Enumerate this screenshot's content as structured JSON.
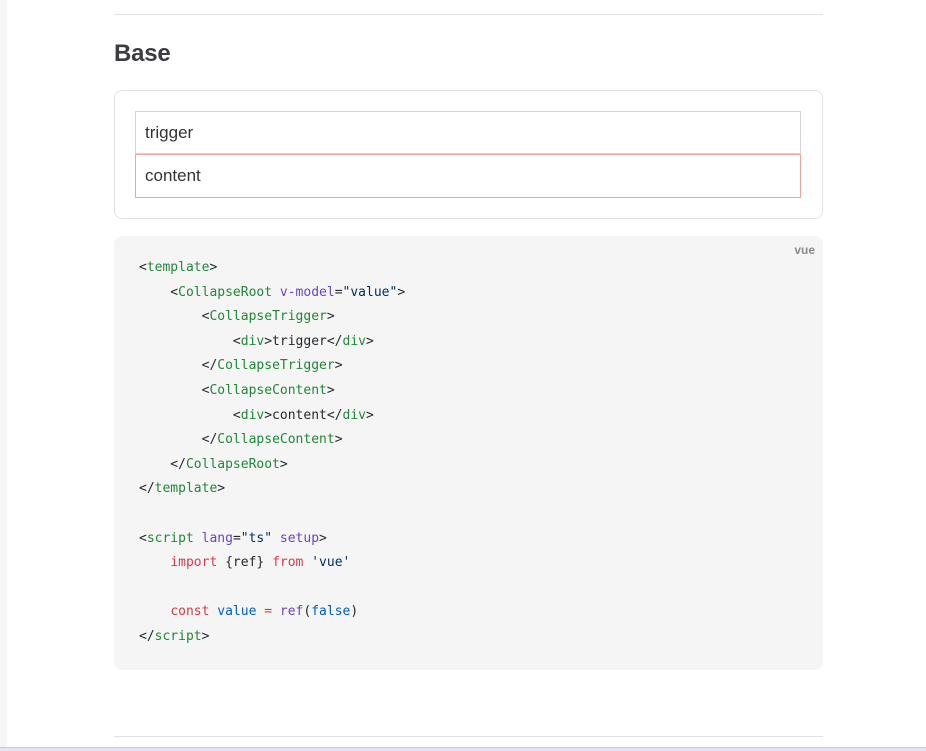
{
  "section": {
    "title": "Base"
  },
  "demo": {
    "trigger_text": "trigger",
    "content_text": "content"
  },
  "code_block": {
    "language": "vue",
    "lines": [
      [
        {
          "c": "p",
          "t": "<"
        },
        {
          "c": "t",
          "t": "template"
        },
        {
          "c": "p",
          "t": ">"
        }
      ],
      [
        {
          "c": "p",
          "t": "    <"
        },
        {
          "c": "t",
          "t": "CollapseRoot"
        },
        {
          "c": "p",
          "t": " "
        },
        {
          "c": "a",
          "t": "v-model"
        },
        {
          "c": "p",
          "t": "="
        },
        {
          "c": "s",
          "t": "\"value\""
        },
        {
          "c": "p",
          "t": ">"
        }
      ],
      [
        {
          "c": "p",
          "t": "        <"
        },
        {
          "c": "t",
          "t": "CollapseTrigger"
        },
        {
          "c": "p",
          "t": ">"
        }
      ],
      [
        {
          "c": "p",
          "t": "            <"
        },
        {
          "c": "t",
          "t": "div"
        },
        {
          "c": "p",
          "t": ">trigger</"
        },
        {
          "c": "t",
          "t": "div"
        },
        {
          "c": "p",
          "t": ">"
        }
      ],
      [
        {
          "c": "p",
          "t": "        </"
        },
        {
          "c": "t",
          "t": "CollapseTrigger"
        },
        {
          "c": "p",
          "t": ">"
        }
      ],
      [
        {
          "c": "p",
          "t": "        <"
        },
        {
          "c": "t",
          "t": "CollapseContent"
        },
        {
          "c": "p",
          "t": ">"
        }
      ],
      [
        {
          "c": "p",
          "t": "            <"
        },
        {
          "c": "t",
          "t": "div"
        },
        {
          "c": "p",
          "t": ">content</"
        },
        {
          "c": "t",
          "t": "div"
        },
        {
          "c": "p",
          "t": ">"
        }
      ],
      [
        {
          "c": "p",
          "t": "        </"
        },
        {
          "c": "t",
          "t": "CollapseContent"
        },
        {
          "c": "p",
          "t": ">"
        }
      ],
      [
        {
          "c": "p",
          "t": "    </"
        },
        {
          "c": "t",
          "t": "CollapseRoot"
        },
        {
          "c": "p",
          "t": ">"
        }
      ],
      [
        {
          "c": "p",
          "t": "</"
        },
        {
          "c": "t",
          "t": "template"
        },
        {
          "c": "p",
          "t": ">"
        }
      ],
      [],
      [
        {
          "c": "p",
          "t": "<"
        },
        {
          "c": "t",
          "t": "script"
        },
        {
          "c": "p",
          "t": " "
        },
        {
          "c": "a",
          "t": "lang"
        },
        {
          "c": "p",
          "t": "="
        },
        {
          "c": "s",
          "t": "\"ts\""
        },
        {
          "c": "p",
          "t": " "
        },
        {
          "c": "a",
          "t": "setup"
        },
        {
          "c": "p",
          "t": ">"
        }
      ],
      [
        {
          "c": "p",
          "t": "    "
        },
        {
          "c": "k",
          "t": "import"
        },
        {
          "c": "p",
          "t": " {ref} "
        },
        {
          "c": "k",
          "t": "from"
        },
        {
          "c": "p",
          "t": " "
        },
        {
          "c": "s",
          "t": "'vue'"
        }
      ],
      [],
      [
        {
          "c": "p",
          "t": "    "
        },
        {
          "c": "k",
          "t": "const"
        },
        {
          "c": "p",
          "t": " "
        },
        {
          "c": "v",
          "t": "value"
        },
        {
          "c": "p",
          "t": " "
        },
        {
          "c": "k",
          "t": "="
        },
        {
          "c": "p",
          "t": " "
        },
        {
          "c": "f",
          "t": "ref"
        },
        {
          "c": "p",
          "t": "("
        },
        {
          "c": "v",
          "t": "false"
        },
        {
          "c": "p",
          "t": ")"
        }
      ],
      [
        {
          "c": "p",
          "t": "</"
        },
        {
          "c": "t",
          "t": "script"
        },
        {
          "c": "p",
          "t": ">"
        }
      ]
    ]
  },
  "colors": {
    "tag": "#22863a",
    "attribute": "#6f42c1",
    "string": "#032f62",
    "keyword": "#d73a49",
    "identifier": "#005cc5",
    "content_border": "#f0a3a3",
    "code_background": "#f5f5f5"
  }
}
